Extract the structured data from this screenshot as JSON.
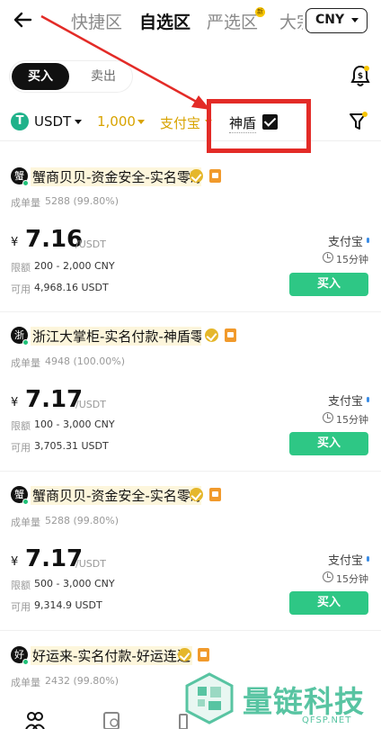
{
  "header": {
    "tabs": [
      "快捷区",
      "自选区",
      "严选区",
      "大宗"
    ],
    "active_tab": "自选区",
    "new_badge": "新",
    "currency": "CNY"
  },
  "segment": {
    "buy": "买入",
    "sell": "卖出",
    "active": "买入"
  },
  "filters": {
    "coin": "USDT",
    "coin_icon": "T",
    "amount": "1,000",
    "payment": "支付宝",
    "shield_label": "神盾",
    "shield_checked": true
  },
  "listings": [
    {
      "avatar": "蟹",
      "merchant": "蟹商贝贝-资金安全-实名零冻",
      "orders_label": "成单量",
      "orders": "5288 (99.80%)",
      "currency_symbol": "¥",
      "price": "7.16",
      "unit": "/USDT",
      "limit_label": "限额",
      "limit": "200 - 2,000 CNY",
      "avail_label": "可用",
      "available": "4,968.16 USDT",
      "payment": "支付宝",
      "time_limit": "15分钟",
      "buy_label": "买入"
    },
    {
      "avatar": "浙",
      "merchant": "浙江大掌柜-实名付款-神盾零...",
      "orders_label": "成单量",
      "orders": "4948 (100.00%)",
      "currency_symbol": "¥",
      "price": "7.17",
      "unit": "/USDT",
      "limit_label": "限额",
      "limit": "100 - 3,000 CNY",
      "avail_label": "可用",
      "available": "3,705.31 USDT",
      "payment": "支付宝",
      "time_limit": "15分钟",
      "buy_label": "买入"
    },
    {
      "avatar": "蟹",
      "merchant": "蟹商贝贝-资金安全-实名零冻",
      "orders_label": "成单量",
      "orders": "5288 (99.80%)",
      "currency_symbol": "¥",
      "price": "7.17",
      "unit": "/USDT",
      "limit_label": "限额",
      "limit": "500 - 3,000 CNY",
      "avail_label": "可用",
      "available": "9,314.9 USDT",
      "payment": "支付宝",
      "time_limit": "15分钟",
      "buy_label": "买入"
    },
    {
      "avatar": "好",
      "merchant": "好运来-实名付款-好运连连",
      "orders_label": "成单量",
      "orders": "2432 (99.80%)"
    }
  ],
  "watermark": {
    "name": "量链科技",
    "url": "QFSP.NET"
  },
  "colors": {
    "accent_gold": "#d8a300",
    "buy_green": "#2ec785",
    "annotation_red": "#e32b27",
    "watermark_green": "#58c4a2"
  }
}
